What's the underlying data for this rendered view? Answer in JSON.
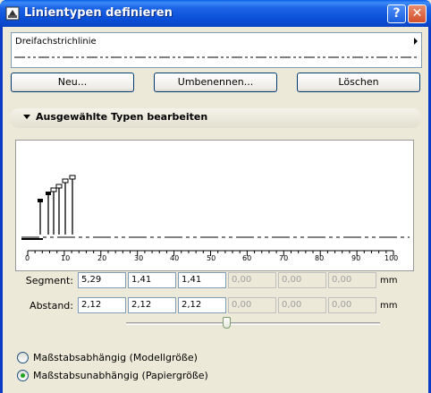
{
  "window": {
    "title": "Linientypen definieren",
    "help_symbol": "?",
    "close_symbol": "✕"
  },
  "linetype": {
    "name": "Dreifachstrichlinie"
  },
  "buttons": {
    "new": "Neu...",
    "rename": "Umbenennen...",
    "delete": "Löschen"
  },
  "section": {
    "title": "Ausgewählte Typen bearbeiten"
  },
  "ruler": {
    "labels": [
      "0",
      "10",
      "20",
      "30",
      "40",
      "50",
      "60",
      "70",
      "80",
      "90",
      "100"
    ]
  },
  "segment": {
    "label": "Segment:",
    "values": [
      "5,29",
      "1,41",
      "1,41",
      "0,00",
      "0,00",
      "0,00"
    ],
    "unit": "mm"
  },
  "gap": {
    "label": "Abstand:",
    "values": [
      "2,12",
      "2,12",
      "2,12",
      "0,00",
      "0,00",
      "0,00"
    ],
    "unit": "mm"
  },
  "slider": {
    "position": 0.39
  },
  "scale_options": {
    "model": "Maßstabsabhängig (Modellgröße)",
    "paper": "Maßstabsunabhängig (Papiergröße)",
    "selected": "paper"
  }
}
